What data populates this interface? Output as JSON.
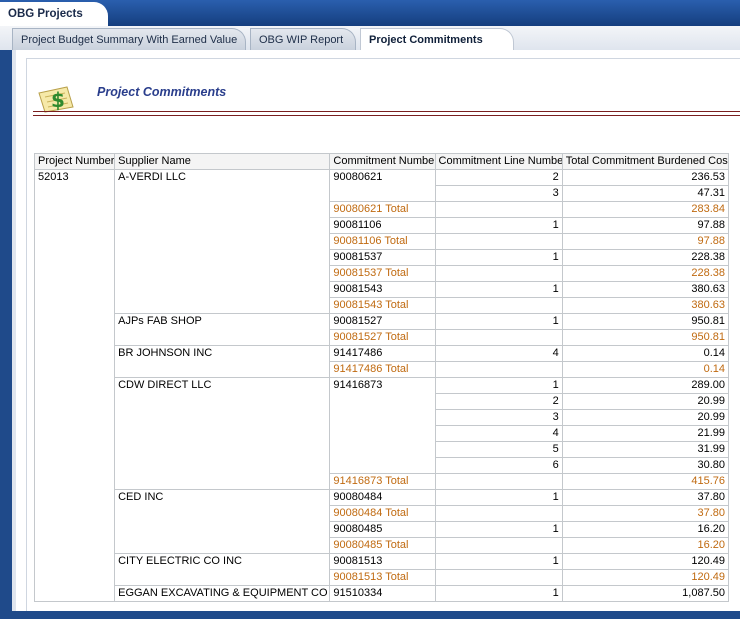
{
  "app": {
    "title": "OBG Projects"
  },
  "tabs": [
    {
      "label": "Project Budget Summary With Earned Value",
      "active": false
    },
    {
      "label": "OBG WIP Report",
      "active": false
    },
    {
      "label": "Project Commitments",
      "active": true
    }
  ],
  "page": {
    "title": "Project Commitments",
    "icon": "money-document-icon"
  },
  "colors": {
    "accent_title": "#2a3e8c",
    "total_text": "#c06a10",
    "chrome": "#1f4a8a",
    "rule": "#7a1f1f"
  },
  "table": {
    "headers": [
      "Project Number",
      "Supplier Name",
      "Commitment Number",
      "Commitment Line Number",
      "Total Commitment Burdened Cost"
    ],
    "project_number": "52013",
    "rows": [
      {
        "supplier": "A-VERDI LLC",
        "commitment": "90080621",
        "line": "2",
        "cost": "236.53"
      },
      {
        "supplier": "",
        "commitment": "",
        "line": "3",
        "cost": "47.31"
      },
      {
        "supplier": "",
        "commitment": "90080621 Total",
        "line": "",
        "cost": "283.84",
        "total": true
      },
      {
        "supplier": "",
        "commitment": "90081106",
        "line": "1",
        "cost": "97.88"
      },
      {
        "supplier": "",
        "commitment": "90081106 Total",
        "line": "",
        "cost": "97.88",
        "total": true
      },
      {
        "supplier": "",
        "commitment": "90081537",
        "line": "1",
        "cost": "228.38"
      },
      {
        "supplier": "",
        "commitment": "90081537 Total",
        "line": "",
        "cost": "228.38",
        "total": true
      },
      {
        "supplier": "",
        "commitment": "90081543",
        "line": "1",
        "cost": "380.63"
      },
      {
        "supplier": "",
        "commitment": "90081543 Total",
        "line": "",
        "cost": "380.63",
        "total": true
      },
      {
        "supplier": "AJPs FAB SHOP",
        "commitment": "90081527",
        "line": "1",
        "cost": "950.81"
      },
      {
        "supplier": "",
        "commitment": "90081527 Total",
        "line": "",
        "cost": "950.81",
        "total": true
      },
      {
        "supplier": "BR JOHNSON INC",
        "commitment": "91417486",
        "line": "4",
        "cost": "0.14"
      },
      {
        "supplier": "",
        "commitment": "91417486 Total",
        "line": "",
        "cost": "0.14",
        "total": true
      },
      {
        "supplier": "CDW DIRECT LLC",
        "commitment": "91416873",
        "line": "1",
        "cost": "289.00"
      },
      {
        "supplier": "",
        "commitment": "",
        "line": "2",
        "cost": "20.99"
      },
      {
        "supplier": "",
        "commitment": "",
        "line": "3",
        "cost": "20.99"
      },
      {
        "supplier": "",
        "commitment": "",
        "line": "4",
        "cost": "21.99"
      },
      {
        "supplier": "",
        "commitment": "",
        "line": "5",
        "cost": "31.99"
      },
      {
        "supplier": "",
        "commitment": "",
        "line": "6",
        "cost": "30.80"
      },
      {
        "supplier": "",
        "commitment": "91416873 Total",
        "line": "",
        "cost": "415.76",
        "total": true
      },
      {
        "supplier": "CED INC",
        "commitment": "90080484",
        "line": "1",
        "cost": "37.80"
      },
      {
        "supplier": "",
        "commitment": "90080484 Total",
        "line": "",
        "cost": "37.80",
        "total": true
      },
      {
        "supplier": "",
        "commitment": "90080485",
        "line": "1",
        "cost": "16.20"
      },
      {
        "supplier": "",
        "commitment": "90080485 Total",
        "line": "",
        "cost": "16.20",
        "total": true
      },
      {
        "supplier": "CITY ELECTRIC CO INC",
        "commitment": "90081513",
        "line": "1",
        "cost": "120.49"
      },
      {
        "supplier": "",
        "commitment": "90081513 Total",
        "line": "",
        "cost": "120.49",
        "total": true
      },
      {
        "supplier": "EGGAN EXCAVATING & EQUIPMENT CO INC",
        "commitment": "91510334",
        "line": "1",
        "cost": "1,087.50"
      }
    ]
  }
}
